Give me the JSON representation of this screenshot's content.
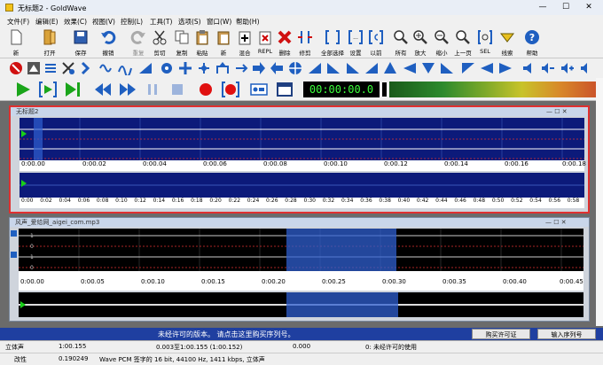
{
  "window": {
    "title": "无标题2 - GoldWave"
  },
  "menu": [
    "文件(F)",
    "编辑(E)",
    "效果(C)",
    "视图(V)",
    "控制(L)",
    "工具(T)",
    "选项(S)",
    "窗口(W)",
    "帮助(H)"
  ],
  "toolbar": [
    {
      "label": "新",
      "icon": "new-icon"
    },
    {
      "label": "打开",
      "icon": "open-icon"
    },
    {
      "label": "保存",
      "icon": "save-icon"
    },
    {
      "label": "撤销",
      "icon": "undo-icon"
    },
    {
      "label": "重复",
      "icon": "redo-icon"
    },
    {
      "label": "剪切",
      "icon": "cut-icon"
    },
    {
      "label": "复制",
      "icon": "copy-icon"
    },
    {
      "label": "粘贴",
      "icon": "paste-icon"
    },
    {
      "label": "新",
      "icon": "paste-new-icon"
    },
    {
      "label": "混合",
      "icon": "mix-icon"
    },
    {
      "label": "REPL",
      "icon": "replace-icon"
    },
    {
      "label": "删除",
      "icon": "delete-icon"
    },
    {
      "label": "修剪",
      "icon": "trim-icon"
    },
    {
      "label": "全部选择",
      "icon": "select-all-icon"
    },
    {
      "label": "设置",
      "icon": "set-selection-icon"
    },
    {
      "label": "以前",
      "icon": "previous-icon"
    },
    {
      "label": "所有",
      "icon": "zoom-all-icon"
    },
    {
      "label": "放大",
      "icon": "zoom-in-icon"
    },
    {
      "label": "缩小",
      "icon": "zoom-out-icon"
    },
    {
      "label": "上一页",
      "icon": "zoom-previous-icon"
    },
    {
      "label": "SEL",
      "icon": "zoom-selection-icon"
    },
    {
      "label": "线索",
      "icon": "cue-icon"
    },
    {
      "label": "帮助",
      "icon": "help-icon"
    }
  ],
  "transport": {
    "time": "00:00:00.0"
  },
  "doc1": {
    "title": "无标题2",
    "ruler_top": [
      "0:00.00",
      "0:00.02",
      "0:00.04",
      "0:00.06",
      "0:00.08",
      "0:00.10",
      "0:00.12",
      "0:00.14",
      "0:00.16",
      "0:00.18"
    ],
    "ruler_bottom": [
      "0:00",
      "0:02",
      "0:04",
      "0:06",
      "0:08",
      "0:10",
      "0:12",
      "0:14",
      "0:16",
      "0:18",
      "0:20",
      "0:22",
      "0:24",
      "0:26",
      "0:28",
      "0:30",
      "0:32",
      "0:34",
      "0:36",
      "0:38",
      "0:40",
      "0:42",
      "0:44",
      "0:46",
      "0:48",
      "0:50",
      "0:52",
      "0:54",
      "0:56",
      "0:58"
    ]
  },
  "doc2": {
    "title": "风声_爱给网_aigei_com.mp3",
    "channel_labels": [
      "1",
      "0",
      "-1",
      "1",
      "0",
      "-1"
    ],
    "ruler": [
      "0:00.00",
      "0:00.05",
      "0:00.10",
      "0:00.15",
      "0:00.20",
      "0:00.25",
      "0:00.30",
      "0:00.35",
      "0:00.40",
      "0:00.45"
    ]
  },
  "nag": {
    "text": "未经许可的版本。 请点击这里购买序列号。",
    "buy_label": "购买许可证",
    "enter_label": "输入序列号"
  },
  "status": {
    "row1": {
      "mode": "立体声",
      "duration": "1:00.155",
      "selection": "0.003至1:00.155 (1:00.152)",
      "position": "0.000",
      "info": "0: 未经许可的使用"
    },
    "row2": {
      "state": "改性",
      "cursor": "0.190249",
      "format": "Wave PCM 签字的 16 bit, 44100 Hz, 1411 kbps, 立体声"
    }
  }
}
